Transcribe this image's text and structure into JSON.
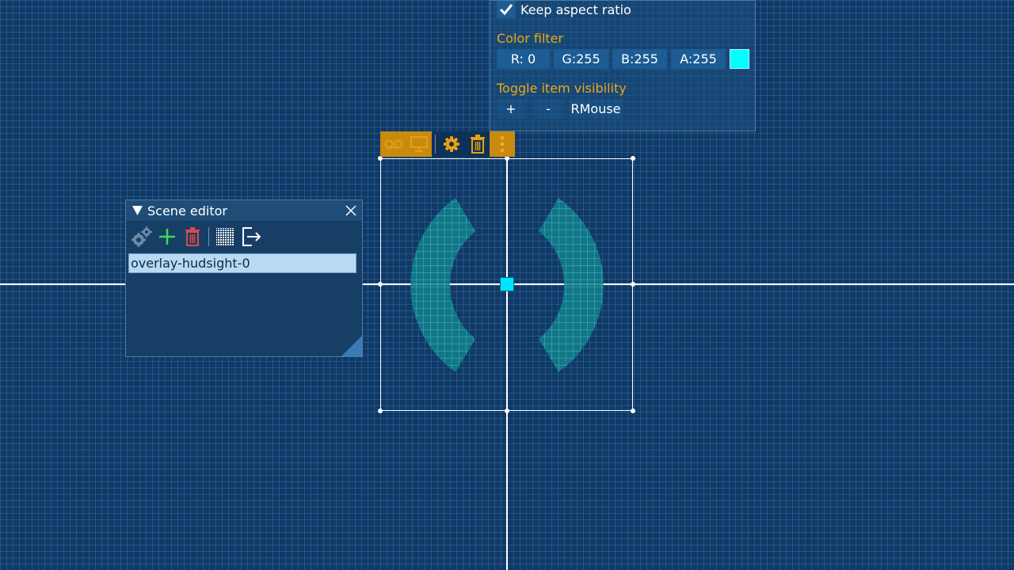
{
  "properties_panel": {
    "keep_aspect_label": "Keep aspect ratio",
    "keep_aspect_checked": true,
    "color_filter_label": "Color filter",
    "color_fields": [
      {
        "label": "R:  0"
      },
      {
        "label": "G:255"
      },
      {
        "label": "B:255"
      },
      {
        "label": "A:255"
      }
    ],
    "swatch_color": "#00ffff",
    "toggle_visibility_label": "Toggle item visibility",
    "toggle_buttons": [
      {
        "label": "+"
      },
      {
        "label": "-"
      },
      {
        "label": "RMouse"
      }
    ]
  },
  "item_toolbar": {
    "icons": [
      "voicemail-icon",
      "monitor-icon",
      "gear-icon",
      "trash-icon",
      "more-vertical-icon"
    ],
    "accent": "#c98a10"
  },
  "scene_editor": {
    "title": "Scene editor",
    "tools": [
      "gears-icon",
      "add-icon",
      "trash-icon",
      "grid-icon",
      "exit-icon"
    ],
    "items": [
      {
        "label": "overlay-hudsight-0",
        "selected": true
      }
    ]
  },
  "hud": {
    "accent": "#00e5ff"
  }
}
